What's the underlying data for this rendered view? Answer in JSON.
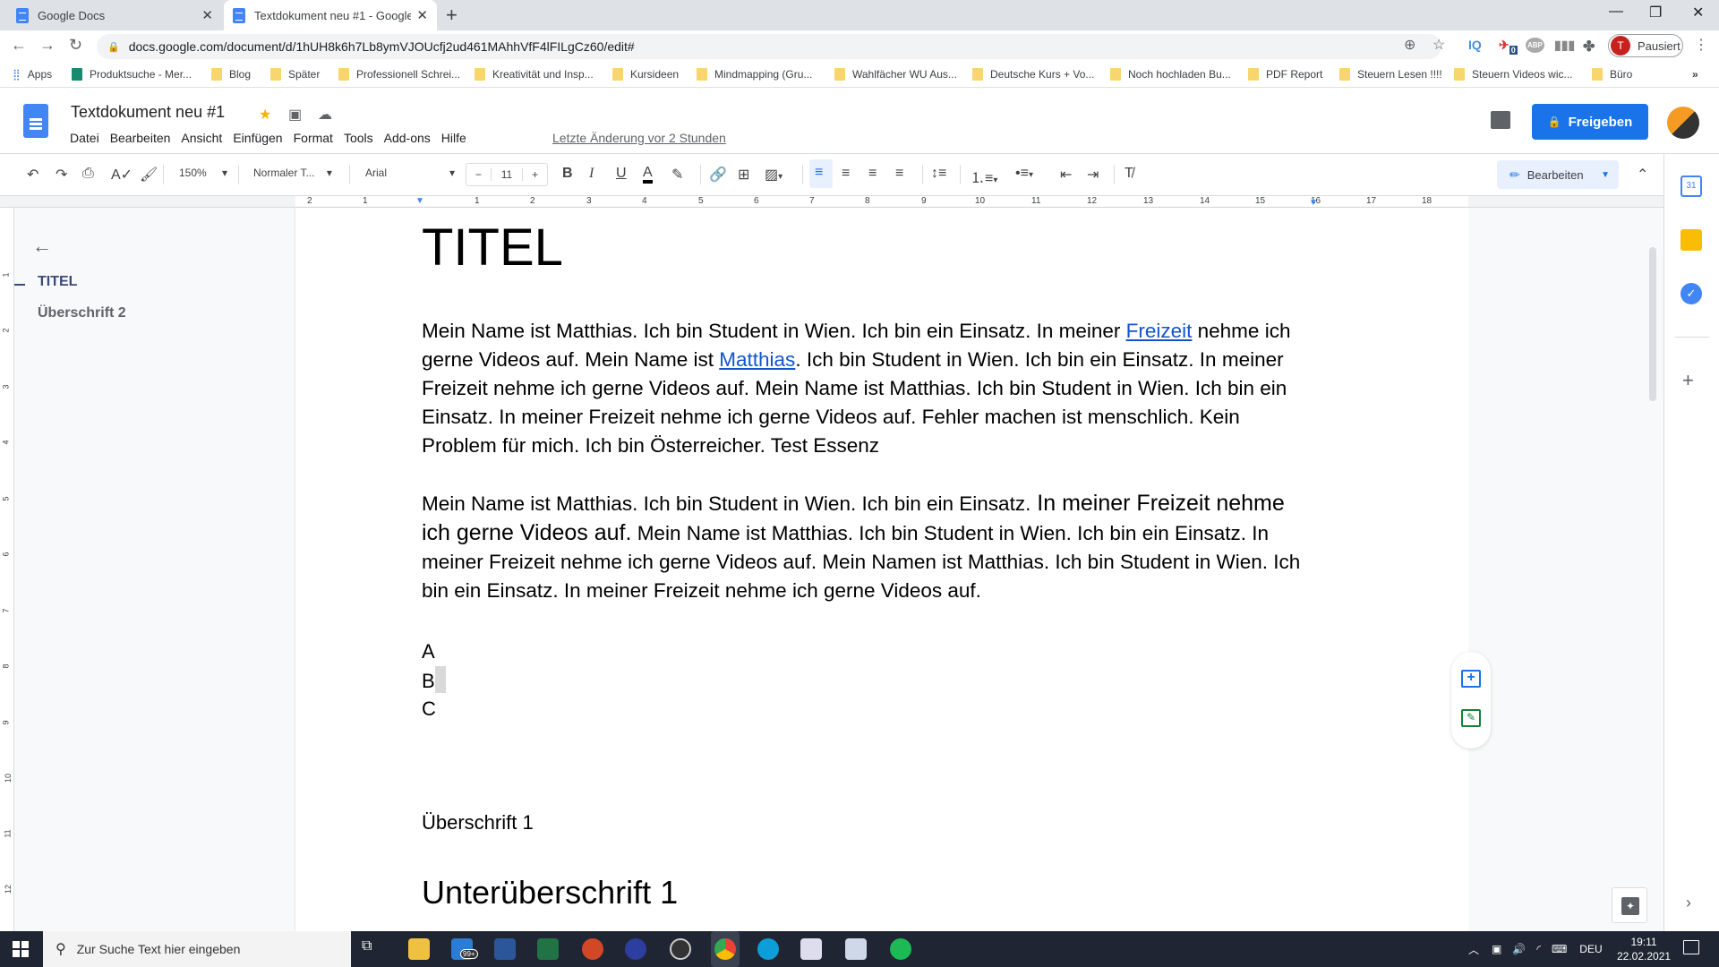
{
  "browser": {
    "tabs": [
      {
        "label": "Google Docs",
        "active": false
      },
      {
        "label": "Textdokument neu #1 - Google D",
        "active": true
      }
    ],
    "url": "docs.google.com/document/d/1hUH8k6h7Lb8ymVJOUcfj2ud461MAhhVfF4lFILgCz60/edit#",
    "profile_initial": "T",
    "profile_status": "Pausiert",
    "extension_badge": "0",
    "extensions": [
      "IQ",
      "ABP"
    ],
    "bookmarks": [
      {
        "label": "Apps",
        "type": "apps"
      },
      {
        "label": "Produktsuche - Mer...",
        "type": "site"
      },
      {
        "label": "Blog",
        "type": "folder"
      },
      {
        "label": "Später",
        "type": "folder"
      },
      {
        "label": "Professionell Schrei...",
        "type": "folder"
      },
      {
        "label": "Kreativität und Insp...",
        "type": "folder"
      },
      {
        "label": "Kursideen",
        "type": "folder"
      },
      {
        "label": "Mindmapping  (Gru...",
        "type": "folder"
      },
      {
        "label": "Wahlfächer WU Aus...",
        "type": "folder"
      },
      {
        "label": "Deutsche Kurs + Vo...",
        "type": "folder"
      },
      {
        "label": "Noch hochladen Bu...",
        "type": "folder"
      },
      {
        "label": "PDF Report",
        "type": "folder"
      },
      {
        "label": "Steuern Lesen !!!!",
        "type": "folder"
      },
      {
        "label": "Steuern Videos wic...",
        "type": "folder"
      },
      {
        "label": "Büro",
        "type": "folder"
      }
    ],
    "bookmarks_overflow": "»"
  },
  "docs": {
    "title": "Textdokument neu #1",
    "menu": [
      "Datei",
      "Bearbeiten",
      "Ansicht",
      "Einfügen",
      "Format",
      "Tools",
      "Add-ons",
      "Hilfe"
    ],
    "last_edit": "Letzte Änderung vor 2 Stunden",
    "share_label": "Freigeben",
    "toolbar": {
      "zoom": "150%",
      "style": "Normaler T...",
      "font": "Arial",
      "font_size": "11",
      "minus": "−",
      "plus": "+",
      "mode_label": "Bearbeiten"
    },
    "ruler_h": [
      "2",
      "1",
      "1",
      "2",
      "3",
      "4",
      "5",
      "6",
      "7",
      "8",
      "9",
      "10",
      "11",
      "12",
      "13",
      "14",
      "15",
      "16",
      "17",
      "18"
    ],
    "ruler_v": [
      "1",
      "2",
      "3",
      "4",
      "5",
      "6",
      "7",
      "8",
      "9",
      "10",
      "11",
      "12"
    ],
    "outline": {
      "items": [
        {
          "label": "TITEL",
          "active": true
        },
        {
          "label": "Überschrift 2",
          "active": false
        }
      ]
    },
    "document": {
      "title": "TITEL",
      "para1": {
        "p1": "Mein Name ist Matthias. Ich bin Student in Wien. Ich bin ein Einsatz. In meiner ",
        "link1": "Freizeit",
        "p2": " nehme ich gerne Videos auf. Mein Name ist ",
        "link2": "Matthias",
        "p3": ". Ich bin Student in Wien. Ich bin ein Einsatz. In meiner Freizeit nehme ich gerne Videos auf. Mein Name ist Matthias. Ich bin Student in Wien. Ich bin ein Einsatz. In meiner Freizeit nehme ich gerne Videos auf. Fehler machen ist menschlich. Kein Problem für mich. Ich bin Österreicher. Test Essenz"
      },
      "para2": {
        "p1": "Mein Name ist Matthias. Ich bin Student in Wien. Ich bin ein Einsatz.",
        "p2": " In meiner Freizeit nehme ich gerne Videos auf.",
        "p3": " Mein Name ist Matthias. Ich bin Student in Wien. Ich bin ein Einsatz. In meiner Freizeit nehme ich gerne Videos auf. Mein Namen ist Matthias. Ich bin Student in Wien. Ich bin ein Einsatz. In meiner Freizeit nehme ich gerne Videos auf."
      },
      "letters": [
        "A",
        "B",
        "C"
      ],
      "heading1": "Überschrift 1",
      "heading2": "Unterüberschrift 1"
    }
  },
  "taskbar": {
    "search_placeholder": "Zur Suche Text hier eingeben",
    "mail_badge": "99+",
    "tray_lang": "DEU",
    "time": "19:11",
    "date": "22.02.2021"
  }
}
